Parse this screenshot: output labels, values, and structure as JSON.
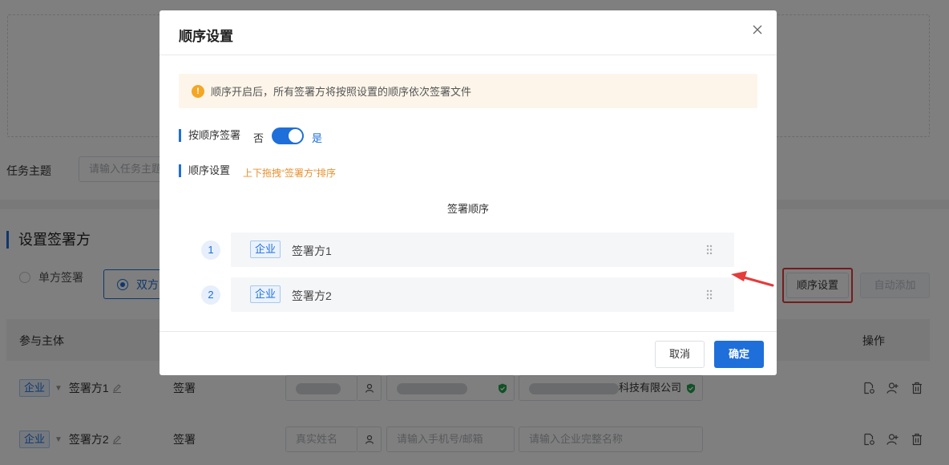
{
  "background": {
    "subject_label": "任务主题",
    "subject_placeholder": "请输入任务主题",
    "section_title": "设置签署方",
    "radio_single": "单方签署",
    "radio_double": "双方",
    "order_button": "顺序设置",
    "auto_add_button": "自动添加",
    "table_headers": {
      "participant": "参与主体",
      "operation": "操作"
    },
    "rows": [
      {
        "tag": "企业",
        "name": "签署方1",
        "action": "签署",
        "company_suffix": "科技有限公司"
      },
      {
        "tag": "企业",
        "name": "签署方2",
        "action": "签署",
        "name_placeholder": "真实姓名",
        "contact_placeholder": "请输入手机号/邮箱",
        "company_placeholder": "请输入企业完整名称"
      }
    ]
  },
  "dialog": {
    "title": "顺序设置",
    "notice": "顺序开启后，所有签署方将按照设置的顺序依次签署文件",
    "sequential_label": "按顺序签署",
    "switch_off_label": "否",
    "switch_on_label": "是",
    "switch_on": true,
    "order_label": "顺序设置",
    "drag_hint": "上下拖拽“签署方”排序",
    "order_heading": "签署顺序",
    "signers": [
      {
        "num": "1",
        "tag": "企业",
        "name": "签署方1"
      },
      {
        "num": "2",
        "tag": "企业",
        "name": "签署方2"
      }
    ],
    "cancel_label": "取消",
    "ok_label": "确定"
  },
  "colors": {
    "accent": "#1e6fd9",
    "warning": "#f5a623",
    "highlight": "#e53b3b"
  }
}
